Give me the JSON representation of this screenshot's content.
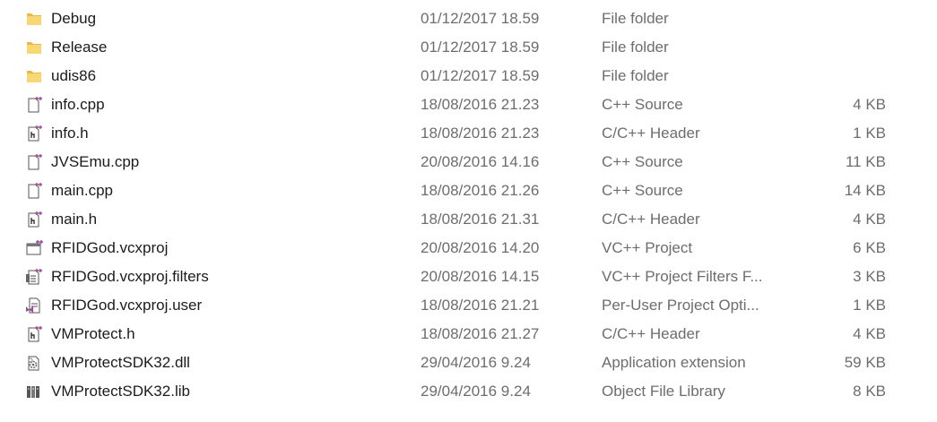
{
  "files": [
    {
      "name": "Debug",
      "date": "01/12/2017 18.59",
      "type": "File folder",
      "size": "",
      "icon": "folder-icon"
    },
    {
      "name": "Release",
      "date": "01/12/2017 18.59",
      "type": "File folder",
      "size": "",
      "icon": "folder-icon"
    },
    {
      "name": "udis86",
      "date": "01/12/2017 18.59",
      "type": "File folder",
      "size": "",
      "icon": "folder-icon"
    },
    {
      "name": "info.cpp",
      "date": "18/08/2016 21.23",
      "type": "C++ Source",
      "size": "4 KB",
      "icon": "cpp-source-icon"
    },
    {
      "name": "info.h",
      "date": "18/08/2016 21.23",
      "type": "C/C++ Header",
      "size": "1 KB",
      "icon": "cpp-header-icon"
    },
    {
      "name": "JVSEmu.cpp",
      "date": "20/08/2016 14.16",
      "type": "C++ Source",
      "size": "11 KB",
      "icon": "cpp-source-icon"
    },
    {
      "name": "main.cpp",
      "date": "18/08/2016 21.26",
      "type": "C++ Source",
      "size": "14 KB",
      "icon": "cpp-source-icon"
    },
    {
      "name": "main.h",
      "date": "18/08/2016 21.31",
      "type": "C/C++ Header",
      "size": "4 KB",
      "icon": "cpp-header-icon"
    },
    {
      "name": "RFIDGod.vcxproj",
      "date": "20/08/2016 14.20",
      "type": "VC++ Project",
      "size": "6 KB",
      "icon": "vcxproj-icon"
    },
    {
      "name": "RFIDGod.vcxproj.filters",
      "date": "20/08/2016 14.15",
      "type": "VC++ Project Filters F...",
      "size": "3 KB",
      "icon": "vcxproj-filters-icon"
    },
    {
      "name": "RFIDGod.vcxproj.user",
      "date": "18/08/2016 21.21",
      "type": "Per-User Project Opti...",
      "size": "1 KB",
      "icon": "vcxproj-user-icon"
    },
    {
      "name": "VMProtect.h",
      "date": "18/08/2016 21.27",
      "type": "C/C++ Header",
      "size": "4 KB",
      "icon": "cpp-header-icon"
    },
    {
      "name": "VMProtectSDK32.dll",
      "date": "29/04/2016 9.24",
      "type": "Application extension",
      "size": "59 KB",
      "icon": "dll-gear-icon"
    },
    {
      "name": "VMProtectSDK32.lib",
      "date": "29/04/2016 9.24",
      "type": "Object File Library",
      "size": "8 KB",
      "icon": "lib-books-icon"
    }
  ],
  "colors": {
    "folder": "#f8d775",
    "folder_dark": "#e8b84a",
    "vs_purple": "#9b4f96",
    "icon_outline": "#555555",
    "text_primary": "#1b1b1b",
    "text_secondary": "#6d6d6d"
  }
}
